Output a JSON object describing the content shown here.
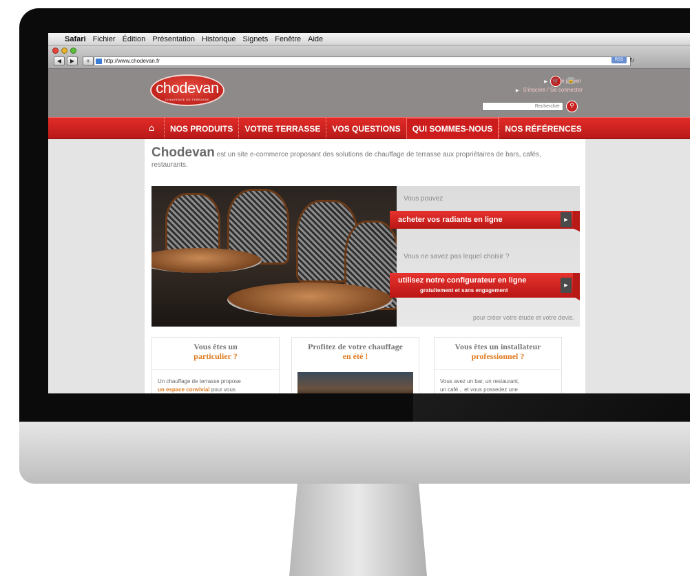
{
  "macos": {
    "menubar": [
      "Safari",
      "Fichier",
      "Édition",
      "Présentation",
      "Historique",
      "Signets",
      "Fenêtre",
      "Aide"
    ],
    "address": "http://www.chodevan.fr",
    "rss": "RSS"
  },
  "site": {
    "logo": "chodevan",
    "logo_sub": "CHAUFFAGE DE TERRASSE",
    "cart_link": "Votre panier",
    "auth_link": "S'inscrire / Se connecter",
    "search_placeholder": "Rechercher",
    "nav": [
      "NOS PRODUITS",
      "VOTRE TERRASSE",
      "VOS QUESTIONS",
      "QUI SOMMES-NOUS",
      "NOS RÉFÉRENCES"
    ],
    "nav_active_index": 3,
    "intro_brand": "Chodevan",
    "intro_rest": " est un site e-commerce proposant des solutions de chauffage de terrasse aux propriétaires de bars, cafés, restaurants.",
    "panel": {
      "vous_pouvez": "Vous pouvez",
      "cta1": "acheter vos radiants en ligne",
      "question": "Vous ne savez pas lequel choisir ?",
      "cta2_line1": "utilisez notre configurateur en ligne",
      "cta2_line2": "gratuitement et sans engagement",
      "footer": "pour créer votre étude et votre devis."
    },
    "boxes": [
      {
        "title_a": "Vous êtes un",
        "title_b": "particulier ?",
        "text_a": "Un chauffage de terrasse propose",
        "text_b": "un espace convivial",
        "text_c": " pour vous"
      },
      {
        "title_a": "Profitez de votre chauffage",
        "title_b": "en été !"
      },
      {
        "title_a": "Vous êtes un installateur",
        "title_b": "professionnel ?",
        "text_a": "Vous avez un bar, un restaurant,",
        "text_b": "un café... et vous possedez une"
      }
    ]
  },
  "colors": {
    "brand_red": "#d52220",
    "header_gray": "#8f8a8a",
    "accent_orange": "#e07a1f"
  }
}
